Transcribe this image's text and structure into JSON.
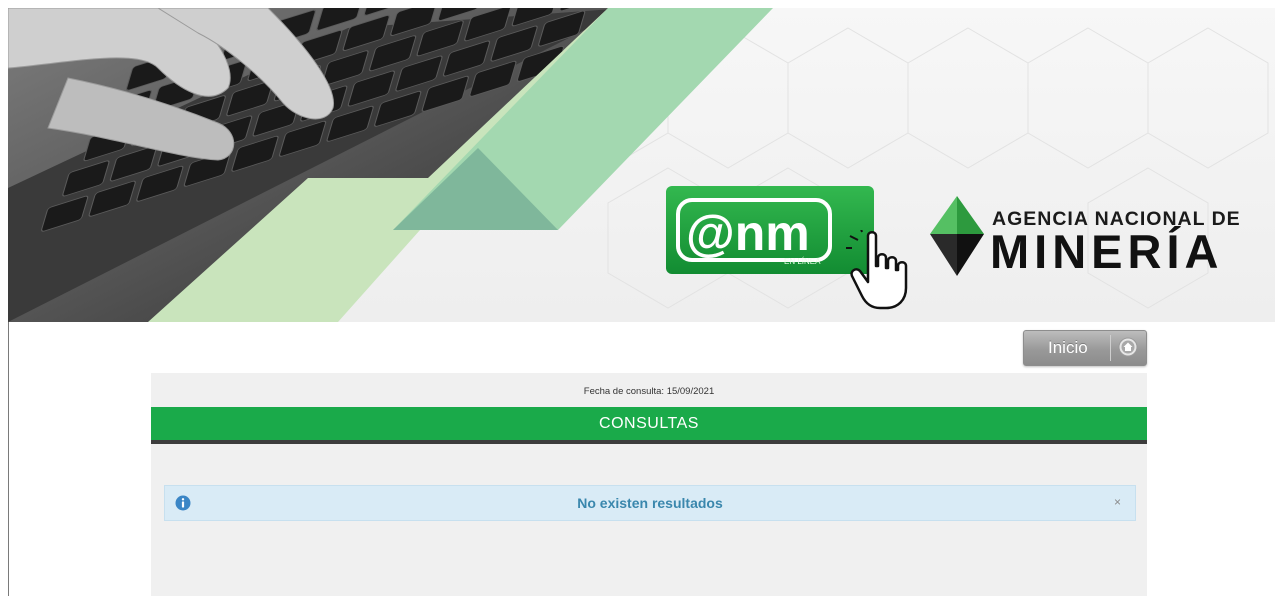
{
  "banner": {
    "anm_logo": {
      "text": "@nm",
      "subtext": "EN LÍNEA",
      "icon": "hand-cursor-icon"
    },
    "agency": {
      "line1": "AGENCIA NACIONAL DE",
      "line2": "MINERÍA",
      "icon": "diamond-icon"
    },
    "colors": {
      "green_light": "#c6e0b4",
      "green_mid": "#a5d8b4",
      "green_dark": "#7fb59a",
      "logo_green": "#1aa13f"
    }
  },
  "nav": {
    "inicio_label": "Inicio",
    "icon": "home-icon"
  },
  "page": {
    "fecha_label": "Fecha de consulta:",
    "fecha_value": "15/09/2021",
    "section_title": "CONSULTAS",
    "colors": {
      "section_bar": "#1aaa4a",
      "alert_bg": "#d9ebf6",
      "alert_text": "#3a87ad"
    }
  },
  "alert": {
    "message": "No existen resultados",
    "close_symbol": "×",
    "icon": "info-icon"
  }
}
